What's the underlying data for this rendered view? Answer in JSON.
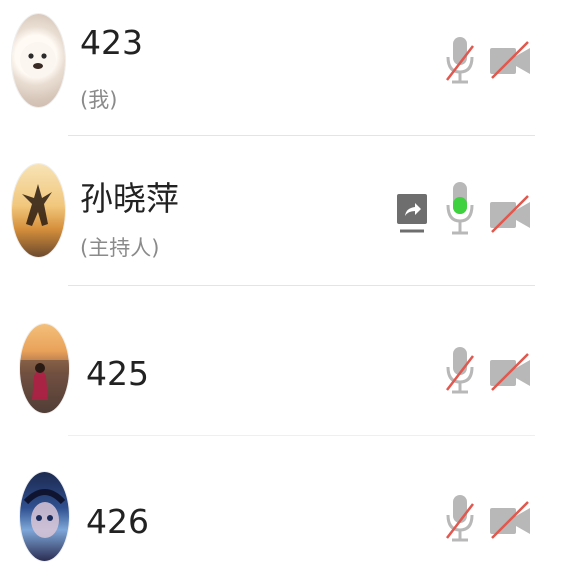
{
  "participants": [
    {
      "name": "423",
      "role": "(我)",
      "mic": "mic-muted",
      "camera": "camera-off"
    },
    {
      "name": "孙晓萍",
      "role": "(主持人)",
      "screen_share": "screen-share",
      "mic": "mic-speaking",
      "camera": "camera-off"
    },
    {
      "name": "425",
      "mic": "mic-muted",
      "camera": "camera-off"
    },
    {
      "name": "426",
      "mic": "mic-muted",
      "camera": "camera-off"
    }
  ],
  "colors": {
    "icon_gray": "#b8b8b8",
    "muted_red": "#e0584f",
    "speaking_green": "#3fd13f",
    "share_gray": "#6e6e6e"
  }
}
